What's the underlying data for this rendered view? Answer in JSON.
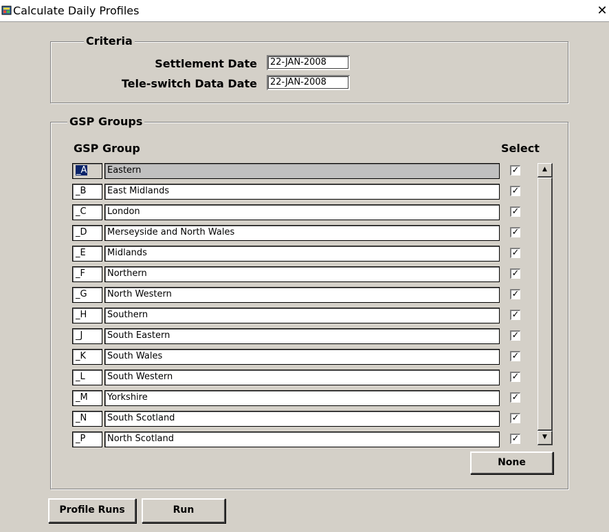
{
  "window": {
    "title": "Calculate Daily Profiles",
    "close_glyph": "✕",
    "app_icon": "app-icon"
  },
  "criteria": {
    "legend": "Criteria",
    "settlement_date_label": "Settlement Date",
    "settlement_date_value": "22-JAN-2008",
    "teleswitch_date_label": "Tele-switch Data Date",
    "teleswitch_date_value": "22-JAN-2008"
  },
  "gsp": {
    "legend": "GSP Groups",
    "col_group": "GSP Group",
    "col_select": "Select",
    "check_glyph": "✓",
    "rows": [
      {
        "code": "_A",
        "name": "Eastern",
        "selected": true
      },
      {
        "code": "_B",
        "name": "East Midlands",
        "selected": true
      },
      {
        "code": "_C",
        "name": "London",
        "selected": true
      },
      {
        "code": "_D",
        "name": "Merseyside and North Wales",
        "selected": true
      },
      {
        "code": "_E",
        "name": "Midlands",
        "selected": true
      },
      {
        "code": "_F",
        "name": "Northern",
        "selected": true
      },
      {
        "code": "_G",
        "name": "North Western",
        "selected": true
      },
      {
        "code": "_H",
        "name": "Southern",
        "selected": true
      },
      {
        "code": "_J",
        "name": "South Eastern",
        "selected": true
      },
      {
        "code": "_K",
        "name": "South Wales",
        "selected": true
      },
      {
        "code": "_L",
        "name": "South Western",
        "selected": true
      },
      {
        "code": "_M",
        "name": "Yorkshire",
        "selected": true
      },
      {
        "code": "_N",
        "name": "South Scotland",
        "selected": true
      },
      {
        "code": "_P",
        "name": "North Scotland",
        "selected": true
      }
    ],
    "none_button": "None",
    "scroll_up_glyph": "▲",
    "scroll_down_glyph": "▼"
  },
  "footer": {
    "profile_runs_button": "Profile Runs",
    "run_button": "Run"
  },
  "colors": {
    "background": "#d4d0c8",
    "highlight": "#0a246a"
  }
}
